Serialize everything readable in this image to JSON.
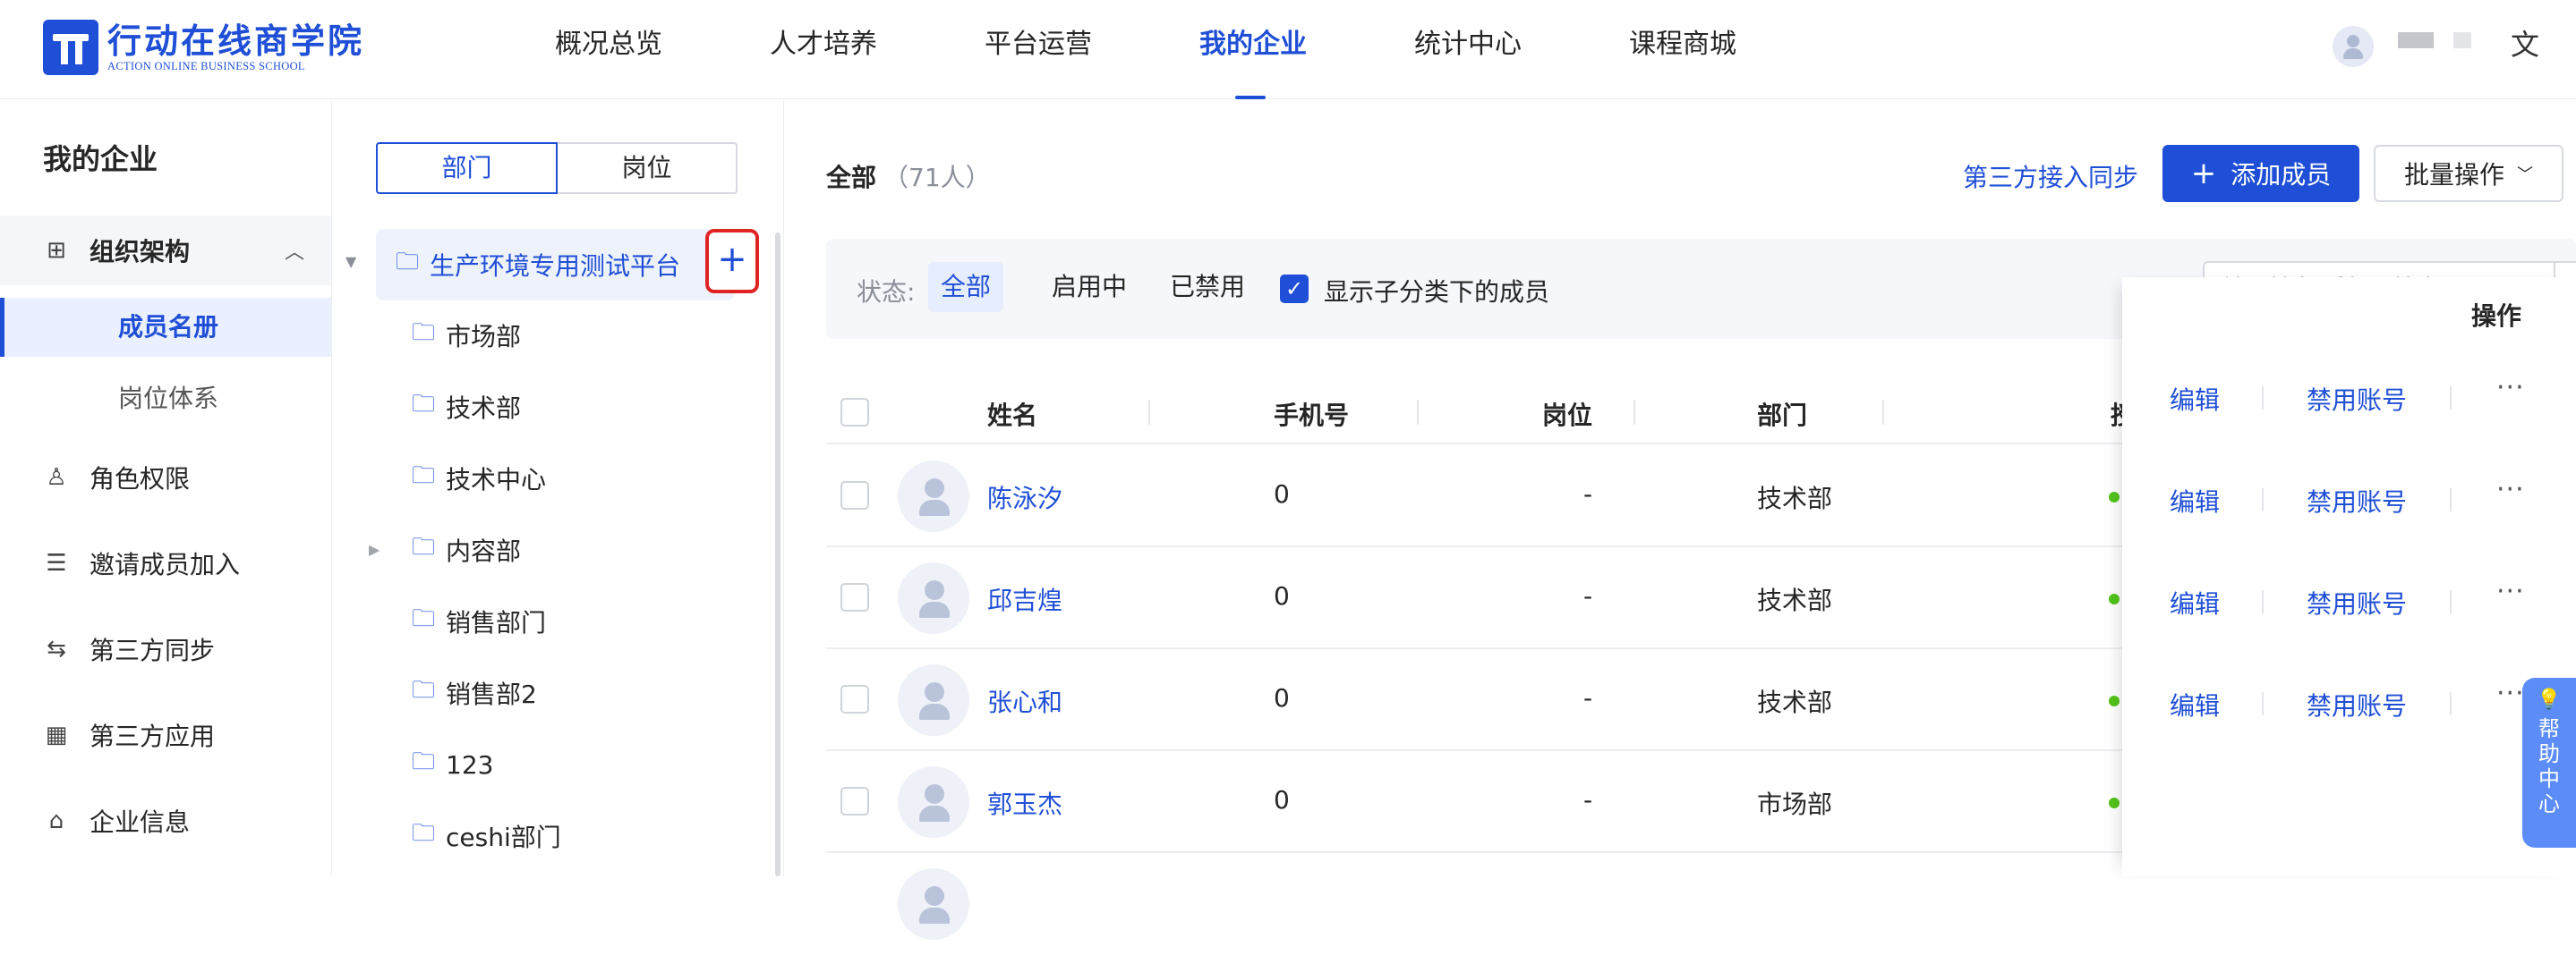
{
  "logo": {
    "title_cn": "行动在线商学院",
    "title_en": "ACTION ONLINE BUSINESS SCHOOL"
  },
  "nav": [
    {
      "label": "概况总览",
      "active": false
    },
    {
      "label": "人才培养",
      "active": false
    },
    {
      "label": "平台运营",
      "active": false
    },
    {
      "label": "我的企业",
      "active": true
    },
    {
      "label": "统计中心",
      "active": false
    },
    {
      "label": "课程商城",
      "active": false
    }
  ],
  "header_icons": {
    "user": "user-avatar-icon",
    "language": "translate-icon"
  },
  "sidebar": {
    "title": "我的企业",
    "group": {
      "label": "组织架构",
      "icon": "org-chart-icon",
      "expanded": true
    },
    "sub_items": [
      {
        "label": "成员名册",
        "active": true
      },
      {
        "label": "岗位体系",
        "active": false
      }
    ],
    "items": [
      {
        "label": "角色权限",
        "icon": "user-key-icon"
      },
      {
        "label": "邀请成员加入",
        "icon": "invite-icon"
      },
      {
        "label": "第三方同步",
        "icon": "sync-icon"
      },
      {
        "label": "第三方应用",
        "icon": "apps-icon"
      },
      {
        "label": "企业信息",
        "icon": "home-icon"
      }
    ]
  },
  "tree": {
    "tabs": [
      "部门",
      "岗位"
    ],
    "active_tab": "部门",
    "root": "生产环境专用测试平台",
    "add_symbol": "+",
    "children": [
      {
        "label": "市场部",
        "has_children": false
      },
      {
        "label": "技术部",
        "has_children": false
      },
      {
        "label": "技术中心",
        "has_children": false
      },
      {
        "label": "内容部",
        "has_children": true
      },
      {
        "label": "销售部门",
        "has_children": false
      },
      {
        "label": "销售部2",
        "has_children": false
      },
      {
        "label": "123",
        "has_children": false
      },
      {
        "label": "ceshi部门",
        "has_children": false
      }
    ]
  },
  "main": {
    "crumb_title": "全部",
    "crumb_count": "（71人）",
    "sync_link": "第三方接入同步",
    "add_member": "添加成员",
    "batch": "批量操作",
    "filter": {
      "label": "状态:",
      "options": [
        {
          "label": "全部",
          "active": true
        },
        {
          "label": "启用中",
          "active": false
        },
        {
          "label": "已禁用",
          "active": false
        }
      ],
      "show_sub_members": "显示子分类下的成员",
      "show_sub_checked": true
    },
    "search": {
      "placeholder": "输入姓名/手机号搜索",
      "value": ""
    },
    "columns": [
      "姓名",
      "手机号",
      "岗位",
      "部门",
      "授权",
      "操作"
    ],
    "rows": [
      {
        "name": "陈泳汐",
        "phone": "0",
        "position": "-",
        "department": "技术部",
        "status": "启用",
        "actions": [
          "编辑",
          "禁用账号"
        ]
      },
      {
        "name": "邱吉煌",
        "phone": "0",
        "position": "-",
        "department": "技术部",
        "status": "启用",
        "actions": [
          "编辑",
          "禁用账号"
        ]
      },
      {
        "name": "张心和",
        "phone": "0",
        "position": "-",
        "department": "技术部",
        "status": "启用",
        "actions": [
          "编辑",
          "禁用账号"
        ]
      },
      {
        "name": "郭玉杰",
        "phone": "0",
        "position": "-",
        "department": "市场部",
        "status": "启用",
        "actions": [
          "编辑",
          "禁用账号"
        ]
      }
    ]
  },
  "help": {
    "label": "帮助中心"
  },
  "colors": {
    "primary": "#1f4fd6",
    "status_active": "#52c41a",
    "highlight_box": "#e02424"
  }
}
